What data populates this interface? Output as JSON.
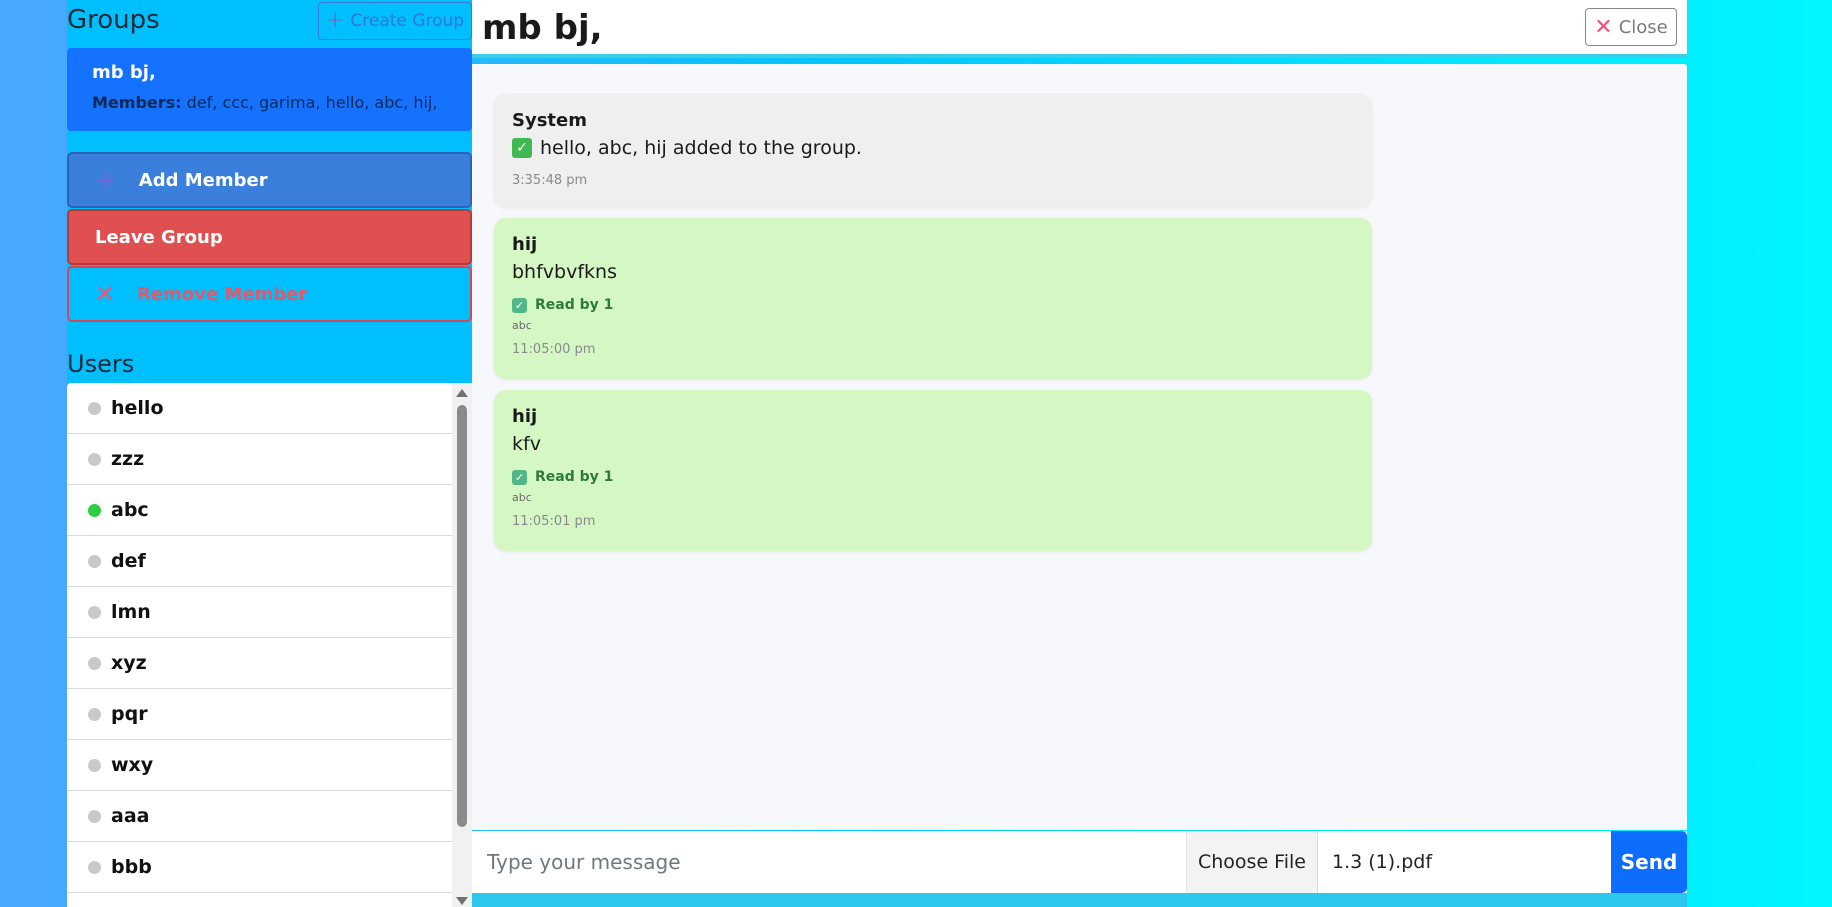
{
  "sidebar": {
    "groups_title": "Groups",
    "create_group_label": "Create Group",
    "group": {
      "name": "mb bj,",
      "members_label": "Members:",
      "members_value": "def, ccc, garima, hello, abc, hij,"
    },
    "add_member_label": "Add Member",
    "leave_group_label": "Leave Group",
    "remove_member_label": "Remove Member",
    "users_title": "Users",
    "users": [
      {
        "name": "hello",
        "online": false
      },
      {
        "name": "zzz",
        "online": false
      },
      {
        "name": "abc",
        "online": true
      },
      {
        "name": "def",
        "online": false
      },
      {
        "name": "lmn",
        "online": false
      },
      {
        "name": "xyz",
        "online": false
      },
      {
        "name": "pqr",
        "online": false
      },
      {
        "name": "wxy",
        "online": false
      },
      {
        "name": "aaa",
        "online": false
      },
      {
        "name": "bbb",
        "online": false
      }
    ]
  },
  "chat": {
    "title": "mb bj,",
    "close_label": "Close",
    "messages": [
      {
        "sender": "System",
        "text": "hello, abc, hij added to the group.",
        "time": "3:35:48 pm"
      },
      {
        "sender": "hij",
        "text": "bhfvbvfkns",
        "read_by": "Read by 1",
        "reader": "abc",
        "time": "11:05:00 pm"
      },
      {
        "sender": "hij",
        "text": "kfv",
        "read_by": "Read by 1",
        "reader": "abc",
        "time": "11:05:01 pm"
      }
    ]
  },
  "composer": {
    "placeholder": "Type your message",
    "choose_file_label": "Choose File",
    "file_name": "1.3 (1).pdf",
    "send_label": "Send"
  },
  "colors": {
    "group_card": "#1472ff",
    "add_member": "#3a7fdc",
    "leave_group": "#e05050",
    "message_bubble": "#d4f7c4",
    "send_button": "#0d6efd",
    "online": "#2ecc40"
  }
}
